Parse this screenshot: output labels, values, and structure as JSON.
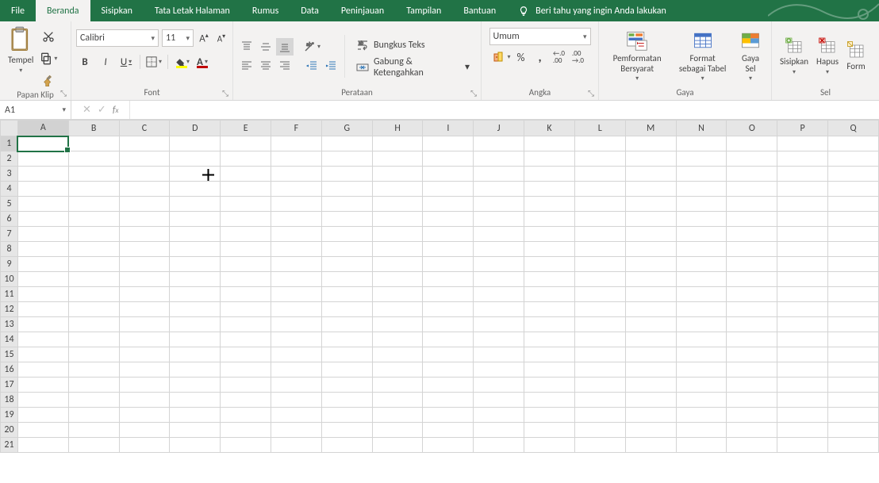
{
  "menu": {
    "file": "File",
    "home": "Beranda",
    "insert": "Sisipkan",
    "layout": "Tata Letak Halaman",
    "formulas": "Rumus",
    "data": "Data",
    "review": "Peninjauan",
    "view": "Tampilan",
    "help": "Bantuan",
    "tellme": "Beri tahu yang ingin Anda lakukan"
  },
  "ribbon": {
    "clipboard": {
      "label": "Papan Klip",
      "paste": "Tempel"
    },
    "font": {
      "label": "Font",
      "name": "Calibri",
      "size": "11",
      "bold": "B",
      "italic": "I",
      "underline": "U",
      "fillColor": "#ffff00",
      "fontColor": "#c00000"
    },
    "alignment": {
      "label": "Perataan",
      "wrap": "Bungkus Teks",
      "merge": "Gabung & Ketengahkan"
    },
    "number": {
      "label": "Angka",
      "format": "Umum"
    },
    "styles": {
      "label": "Gaya",
      "cond": "Pemformatan Bersyarat",
      "table": "Format sebagai Tabel",
      "cell": "Gaya Sel"
    },
    "cells": {
      "label": "Sel",
      "insert": "Sisipkan",
      "delete": "Hapus",
      "format": "Form"
    }
  },
  "namebox": "A1",
  "formula": "",
  "columns": [
    "A",
    "B",
    "C",
    "D",
    "E",
    "F",
    "G",
    "H",
    "I",
    "J",
    "K",
    "L",
    "M",
    "N",
    "O",
    "P",
    "Q"
  ],
  "rows": [
    1,
    2,
    3,
    4,
    5,
    6,
    7,
    8,
    9,
    10,
    11,
    12,
    13,
    14,
    15,
    16,
    17,
    18,
    19,
    20,
    21
  ],
  "selected": {
    "row": 1,
    "col": "A"
  }
}
